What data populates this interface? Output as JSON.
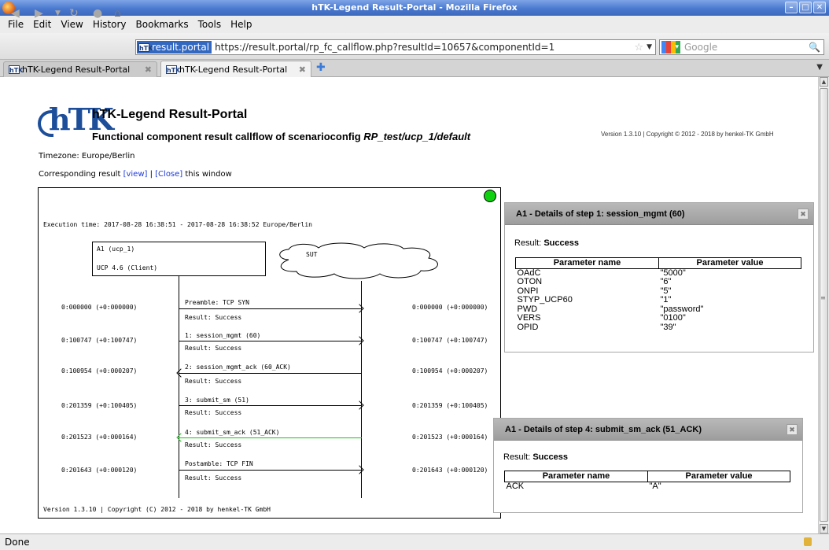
{
  "window": {
    "title": "hTK-Legend Result-Portal - Mozilla Firefox"
  },
  "menu": [
    "File",
    "Edit",
    "View",
    "History",
    "Bookmarks",
    "Tools",
    "Help"
  ],
  "urlbar": {
    "site_label": "result.portal",
    "favicon_text": "hTK",
    "url": "https://result.portal/rp_fc_callflow.php?resultId=10657&componentId=1"
  },
  "search": {
    "placeholder": "Google"
  },
  "tabs": [
    {
      "label": "hTK-Legend Result-Portal",
      "active": false
    },
    {
      "label": "hTK-Legend Result-Portal",
      "active": true
    }
  ],
  "page": {
    "logo_text": "hTK",
    "title": "hTK-Legend Result-Portal",
    "subtitle_prefix": "Functional component result callflow of scenarioconfig",
    "subtitle_config": "RP_test/ucp_1/default",
    "version_top": "Version 1.3.10 | Copyright © 2012 - 2018 by henkel-TK GmbH",
    "timezone": "Timezone: Europe/Berlin",
    "corresponding_prefix": "Corresponding result",
    "view_link": "[view]",
    "separator": "|",
    "close_link": "[Close]",
    "corresponding_suffix": "this window"
  },
  "callflow": {
    "execution_time": "Execution time: 2017-08-28 16:38:51 - 2017-08-28 16:38:52 Europe/Berlin",
    "agent_name": "A1 (ucp_1)",
    "agent_protocol": "UCP 4.6 (Client)",
    "sut_label": "SUT",
    "steps": [
      {
        "time": "0:000000 (+0:000000)",
        "label": "Preamble: TCP SYN",
        "result": "Result: Success",
        "direction": "right",
        "highlight": false
      },
      {
        "time": "0:100747 (+0:100747)",
        "label": "1: session_mgmt (60)",
        "result": "Result: Success",
        "direction": "right",
        "highlight": false
      },
      {
        "time": "0:100954 (+0:000207)",
        "label": "2: session_mgmt_ack (60_ACK)",
        "result": "Result: Success",
        "direction": "left",
        "highlight": false
      },
      {
        "time": "0:201359 (+0:100405)",
        "label": "3: submit_sm (51)",
        "result": "Result: Success",
        "direction": "right",
        "highlight": false
      },
      {
        "time": "0:201523 (+0:000164)",
        "label": "4: submit_sm_ack (51_ACK)",
        "result": "Result: Success",
        "direction": "left",
        "highlight": true
      },
      {
        "time": "0:201643 (+0:000120)",
        "label": "Postamble: TCP FIN",
        "result": "Result: Success",
        "direction": "right",
        "highlight": false
      }
    ],
    "footer": "Version 1.3.10 | Copyright (C) 2012 - 2018 by henkel-TK GmbH",
    "status_color": "#0fd10f"
  },
  "panels": [
    {
      "title": "A1 - Details of step 1: session_mgmt (60)",
      "result_label": "Result:",
      "result_value": "Success",
      "headers": [
        "Parameter name",
        "Parameter value"
      ],
      "rows": [
        [
          "OAdC",
          "\"5000\""
        ],
        [
          "OTON",
          "\"6\""
        ],
        [
          "ONPI",
          "\"5\""
        ],
        [
          "STYP_UCP60",
          "\"1\""
        ],
        [
          "PWD",
          "\"password\""
        ],
        [
          "VERS",
          "\"0100\""
        ],
        [
          "OPID",
          "\"39\""
        ]
      ]
    },
    {
      "title": "A1 - Details of step 4: submit_sm_ack (51_ACK)",
      "result_label": "Result:",
      "result_value": "Success",
      "headers": [
        "Parameter name",
        "Parameter value"
      ],
      "rows": [
        [
          "ACK",
          "\"A\""
        ]
      ]
    }
  ],
  "status": {
    "text": "Done"
  },
  "colors": {
    "accent": "#3368c0",
    "link": "#1c39d8",
    "highlight_arrow": "#17c117",
    "titlebar": "#4a79cf"
  }
}
